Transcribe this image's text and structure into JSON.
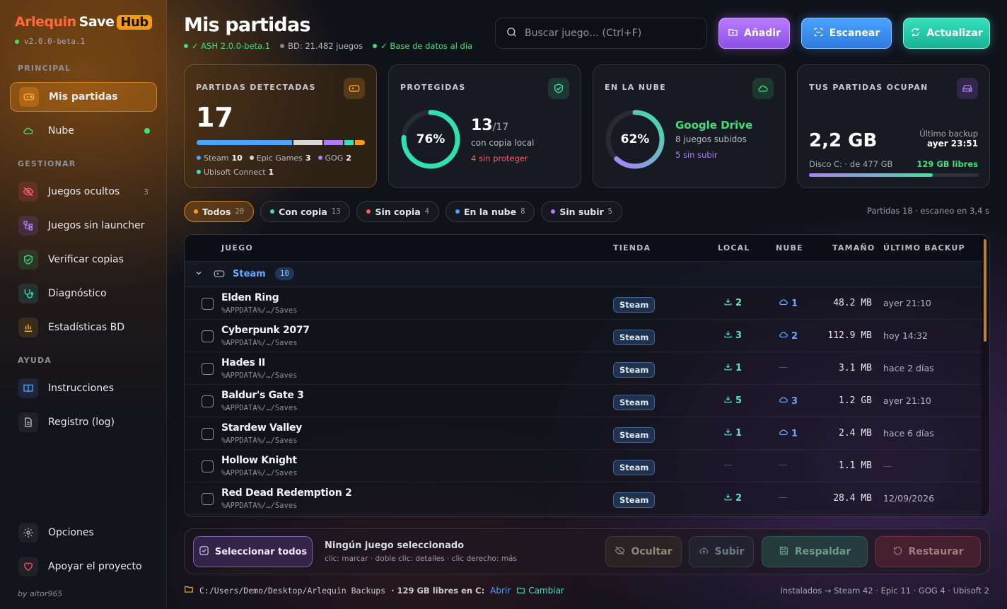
{
  "brand": {
    "name_a": "Arlequin",
    "name_b": "Save",
    "hub": "Hub",
    "version": "v2.0.0-beta.1"
  },
  "sidebar": {
    "sections": [
      "PRINCIPAL",
      "GESTIONAR",
      "AYUDA"
    ],
    "items": [
      {
        "label": "Mis partidas",
        "icon": "gamepad-icon"
      },
      {
        "label": "Nube",
        "icon": "cloud-icon"
      },
      {
        "label": "Juegos ocultos",
        "icon": "eye-off-icon",
        "count": "3"
      },
      {
        "label": "Juegos sin launcher",
        "icon": "tree-icon"
      },
      {
        "label": "Verificar copias",
        "icon": "shield-check-icon"
      },
      {
        "label": "Diagnóstico",
        "icon": "stethoscope-icon"
      },
      {
        "label": "Estadísticas BD",
        "icon": "bar-chart-icon"
      },
      {
        "label": "Instrucciones",
        "icon": "book-icon"
      },
      {
        "label": "Registro (log)",
        "icon": "file-icon"
      },
      {
        "label": "Opciones",
        "icon": "gear-icon"
      },
      {
        "label": "Apoyar el proyecto",
        "icon": "heart-icon"
      }
    ],
    "byline": "by aitor965"
  },
  "header": {
    "title": "Mis partidas",
    "status_ash": "✓ ASH 2.0.0-beta.1",
    "status_bd": "BD: 21.482 juegos",
    "status_db": "✓ Base de datos al día",
    "search_placeholder": "Buscar juego… (Ctrl+F)",
    "btn_add": "Añadir",
    "btn_scan": "Escanear",
    "btn_update": "Actualizar"
  },
  "cards": {
    "detected": {
      "label": "PARTIDAS DETECTADAS",
      "value": "17",
      "legend": [
        {
          "name": "Steam",
          "n": "10",
          "color": "#4aa3ff",
          "share": 10
        },
        {
          "name": "Epic Games",
          "n": "3",
          "color": "#d8d8d8",
          "share": 3
        },
        {
          "name": "GOG",
          "n": "2",
          "color": "#b07cff",
          "share": 2
        },
        {
          "name": "Ubisoft Connect",
          "n": "1",
          "color": "#3fe0b0",
          "share": 1
        }
      ],
      "bar_orange_share": 1
    },
    "protected": {
      "label": "PROTEGIDAS",
      "pct": "76%",
      "pct_val": 76,
      "count": "13",
      "total": "/17",
      "caption": "con copia local",
      "warn": "4 sin proteger"
    },
    "cloud": {
      "label": "EN LA NUBE",
      "pct": "62%",
      "pct_val": 62,
      "provider": "Google Drive",
      "caption": "8 juegos subidos",
      "pending": "5 sin subir"
    },
    "storage": {
      "label": "TUS PARTIDAS OCUPAN",
      "value": "2,2 GB",
      "last_label": "Último backup",
      "last_value": "ayer 23:51",
      "disk": "Disco C: · de 477 GB",
      "free": "129 GB libres",
      "fill": 0.73
    }
  },
  "filters": [
    {
      "label": "Todos",
      "n": "20",
      "color": "#ff9a1f"
    },
    {
      "label": "Con copia",
      "n": "13",
      "color": "#3fe0a0"
    },
    {
      "label": "Sin copia",
      "n": "4",
      "color": "#ff5a5a"
    },
    {
      "label": "En la nube",
      "n": "8",
      "color": "#4aa3ff"
    },
    {
      "label": "Sin subir",
      "n": "5",
      "color": "#b07cff"
    }
  ],
  "scan_info": "Partidas 18 · escaneo en 3,4 s",
  "table": {
    "headers": [
      "JUEGO",
      "TIENDA",
      "LOCAL",
      "NUBE",
      "TAMAÑO",
      "ÚLTIMO BACKUP"
    ],
    "group": {
      "name": "Steam",
      "count": "10"
    },
    "rows": [
      {
        "name": "Elden Ring",
        "path": "%APPDATA%/…/Saves",
        "store": "Steam",
        "local": "2",
        "cloud": "1",
        "size": "48.2 MB",
        "backup": "ayer 21:10"
      },
      {
        "name": "Cyberpunk 2077",
        "path": "%APPDATA%/…/Saves",
        "store": "Steam",
        "local": "3",
        "cloud": "2",
        "size": "112.9 MB",
        "backup": "hoy 14:32"
      },
      {
        "name": "Hades II",
        "path": "%APPDATA%/…/Saves",
        "store": "Steam",
        "local": "1",
        "cloud": "—",
        "size": "3.1 MB",
        "backup": "hace 2 días"
      },
      {
        "name": "Baldur's Gate 3",
        "path": "%APPDATA%/…/Saves",
        "store": "Steam",
        "local": "5",
        "cloud": "3",
        "size": "1.2 GB",
        "backup": "ayer 21:10"
      },
      {
        "name": "Stardew Valley",
        "path": "%APPDATA%/…/Saves",
        "store": "Steam",
        "local": "1",
        "cloud": "1",
        "size": "2.4 MB",
        "backup": "hace 6 días"
      },
      {
        "name": "Hollow Knight",
        "path": "%APPDATA%/…/Saves",
        "store": "Steam",
        "local": "—",
        "cloud": "—",
        "size": "1.1 MB",
        "backup": "—"
      },
      {
        "name": "Red Dead Redemption 2",
        "path": "%APPDATA%/…/Saves",
        "store": "Steam",
        "local": "2",
        "cloud": "—",
        "size": "28.4 MB",
        "backup": "12/09/2026"
      }
    ]
  },
  "actions": {
    "select_all": "Seleccionar todos",
    "none": "Ningún juego seleccionado",
    "hint": "clic: marcar · doble clic: detalles · clic derecho: más",
    "hide": "Ocultar",
    "upload": "Subir",
    "backup": "Respaldar",
    "restore": "Restaurar"
  },
  "footer": {
    "path": "C:/Users/Demo/Desktop/Arlequin Backups",
    "free": "· 129 GB libres en C:",
    "open": "Abrir",
    "change": "Cambiar",
    "installed": "instalados → Steam 42 · Epic 11 · GOG 4 · Ubisoft 2"
  }
}
